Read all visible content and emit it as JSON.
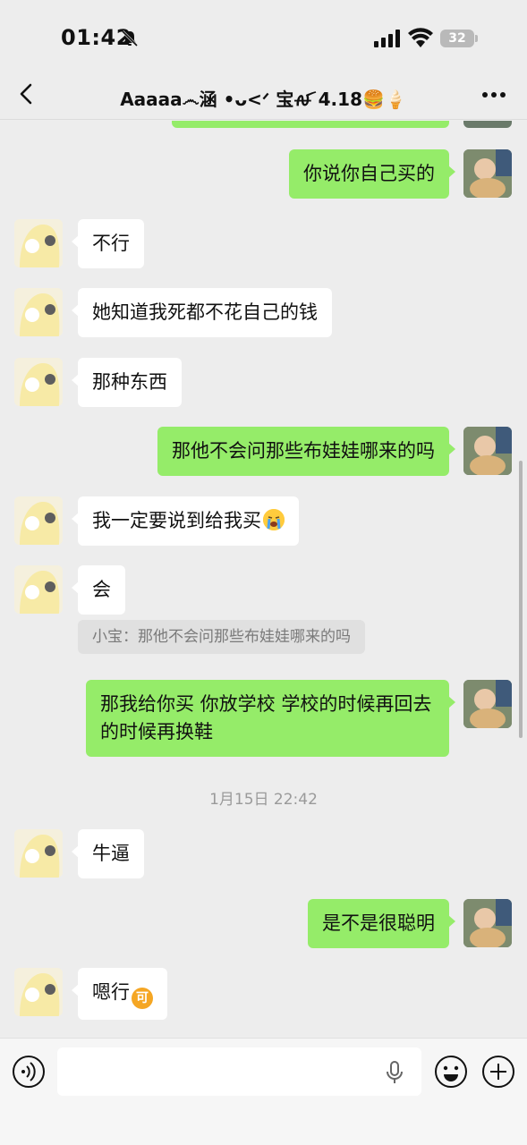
{
  "status_bar": {
    "time": "01:42",
    "battery": "32"
  },
  "nav": {
    "title": "Aaaaa෴涵 •ᴗ<ᐟ 宝ꫛ 4.18🍔🍦"
  },
  "messages": [
    {
      "side": "right",
      "text": "你说你自己买的"
    },
    {
      "side": "left",
      "text": "不行"
    },
    {
      "side": "left",
      "text": "她知道我死都不花自己的钱"
    },
    {
      "side": "left",
      "text": "那种东西"
    },
    {
      "side": "right",
      "text": "那他不会问那些布娃娃哪来的吗"
    },
    {
      "side": "left",
      "text": "我一定要说到给我买",
      "emoji": "crying-face"
    },
    {
      "side": "left",
      "text": "会",
      "quote": "小宝：那他不会问那些布娃娃哪来的吗"
    },
    {
      "side": "right",
      "text": "那我给你买 你放学校 学校的时候再回去的时候再换鞋"
    },
    {
      "side": "left",
      "text": "牛逼"
    },
    {
      "side": "right",
      "text": "是不是很聪明"
    },
    {
      "side": "left",
      "text": "嗯行",
      "emoji": "ke-sticker",
      "emoji_text": "可"
    }
  ],
  "timestamp": "1月15日 22:42",
  "input": {
    "value": "",
    "placeholder": ""
  },
  "colors": {
    "background": "#ededed",
    "self_bubble": "#95ec69",
    "other_bubble": "#ffffff"
  },
  "icons": [
    "back-icon",
    "more-icon",
    "voice-icon",
    "mic-icon",
    "emoji-icon",
    "plus-icon",
    "bell-mute-icon",
    "signal-icon",
    "wifi-icon",
    "battery-icon"
  ]
}
